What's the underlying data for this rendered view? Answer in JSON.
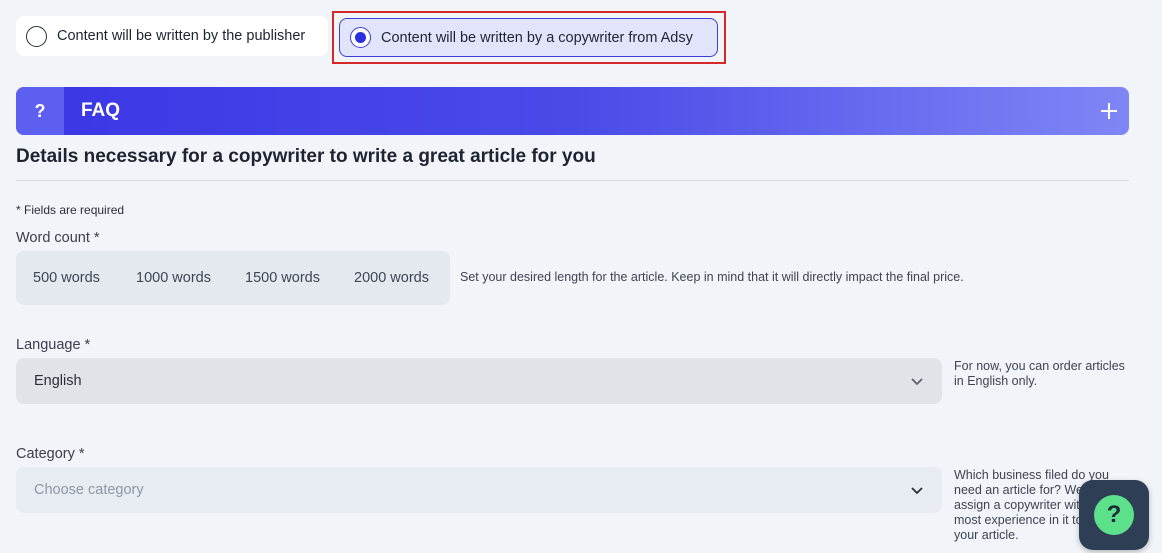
{
  "content_options": {
    "publisher_label": "Content will be written by the publisher",
    "copywriter_label": "Content will be written by a copywriter from Adsy",
    "selected": "copywriter"
  },
  "faq": {
    "icon_label": "?",
    "title": "FAQ",
    "expand_symbol": "+"
  },
  "section_title": "Details necessary for a copywriter to write a great article for you",
  "required_note": "* Fields are required",
  "word_count": {
    "label": "Word count *",
    "options": [
      "500 words",
      "1000 words",
      "1500 words",
      "2000 words"
    ],
    "hint": "Set your desired length for the article. Keep in mind that it will directly impact the final price."
  },
  "language": {
    "label": "Language *",
    "value": "English",
    "hint_line1": "For now, you can order articles",
    "hint_line2": "in English only."
  },
  "category": {
    "label": "Category *",
    "placeholder": "Choose category",
    "hint_line1": "Which business filed do you",
    "hint_line2": "need an article for? We'll",
    "hint_line3": "assign a copywriter with",
    "hint_line4": "most experience in it to w",
    "hint_line5": "your article."
  },
  "help_widget": {
    "symbol": "?"
  },
  "colors": {
    "accent": "#3b3fd8",
    "highlight_border": "#d62828",
    "help_bubble": "#5ce08a"
  }
}
